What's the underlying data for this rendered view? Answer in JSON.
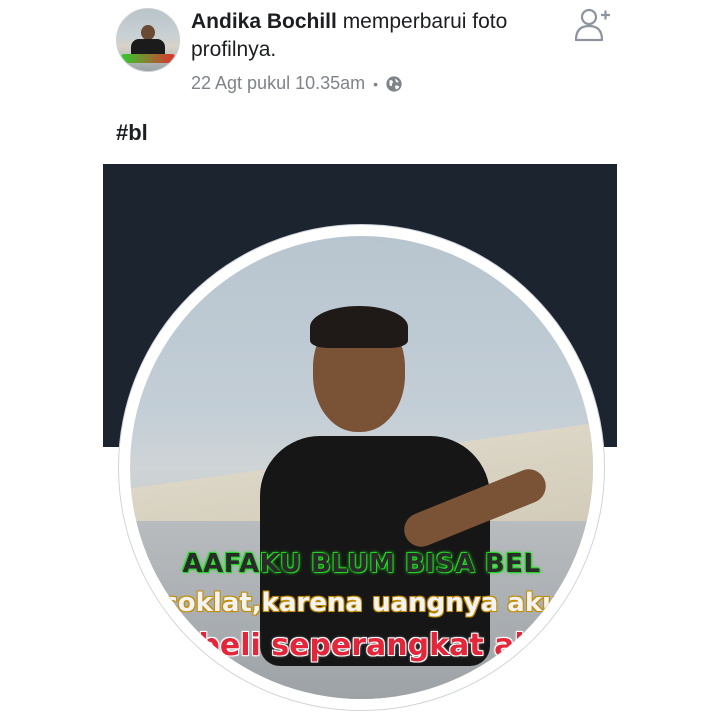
{
  "post": {
    "author": "Andika Bochill",
    "action": " memperbarui foto profilnya.",
    "timestamp": "22 Agt pukul 10.35am",
    "separator": "•",
    "privacy_icon": "globe-icon",
    "hashtag": "#bl"
  },
  "header": {
    "add_friend_icon": "add-friend-icon"
  },
  "profile_photo": {
    "caption_lines": [
      "AAFAKU BLUM BISA BEL",
      "coklat,karena uangnya aku",
      "beli seperangkat al"
    ]
  },
  "colors": {
    "cover": "#1c2430",
    "meta_text": "#7f838a",
    "caption_green": "#28e028",
    "caption_red": "#e4263a"
  }
}
